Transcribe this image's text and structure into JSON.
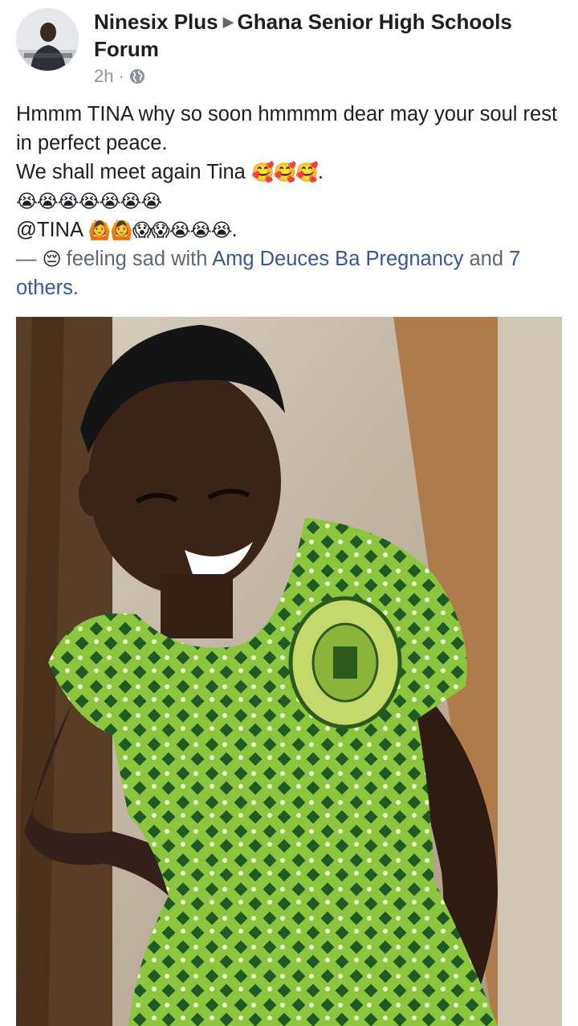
{
  "post": {
    "author": "Ninesix Plus",
    "group": "Ghana Senior High Schools Forum",
    "time": "2h",
    "separator": "·",
    "privacy_icon": "globe-icon",
    "text": {
      "line1": "Hmmm TINA why so soon hmmmm dear may your soul rest in perfect peace.",
      "line2_text": "We shall meet again Tina ",
      "line2_emojis": "🥰🥰🥰",
      "line2_end": ".",
      "line3_emojis": "😭😭😭😭😭😭😭",
      "line4_text": "@TINA ",
      "line4_emojis": "🙆🙆😱😱😭😭😭",
      "line4_end": ".",
      "feeling_dash": "— ",
      "feeling_emoji": "😔",
      "feeling_text": " feeling sad with ",
      "tag_name": "Amg Deuces Ba Pregnancy",
      "and_text": " and ",
      "others": "7 others."
    },
    "image": {
      "description_icon": "photo-of-girl-in-green-uniform"
    }
  },
  "colors": {
    "link": "#365899",
    "meta": "#90949c",
    "text": "#1c1e21",
    "uniform_green": "#8cc63f",
    "uniform_dark": "#1f5a24"
  }
}
